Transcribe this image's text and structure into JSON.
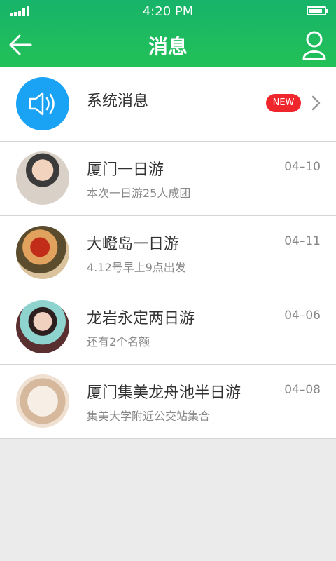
{
  "status": {
    "time": "4:20 PM"
  },
  "header": {
    "title": "消息"
  },
  "system": {
    "title": "系统消息",
    "badge": "NEW"
  },
  "messages": [
    {
      "title": "厦门一日游",
      "subtitle": "本次一日游25人成团",
      "date": "04–10"
    },
    {
      "title": "大嶝岛一日游",
      "subtitle": "4.12号早上9点出发",
      "date": "04–11"
    },
    {
      "title": "龙岩永定两日游",
      "subtitle": "还有2个名额",
      "date": "04–06"
    },
    {
      "title": "厦门集美龙舟池半日游",
      "subtitle": "集美大学附近公交站集合",
      "date": "04–08"
    }
  ],
  "colors": {
    "header": "#1ab668",
    "system_icon": "#1aa3f4",
    "badge": "#f0262d"
  },
  "icons": {
    "back": "arrow-left-icon",
    "profile": "user-icon",
    "system": "speaker-icon",
    "chevron": "chevron-right-icon"
  }
}
